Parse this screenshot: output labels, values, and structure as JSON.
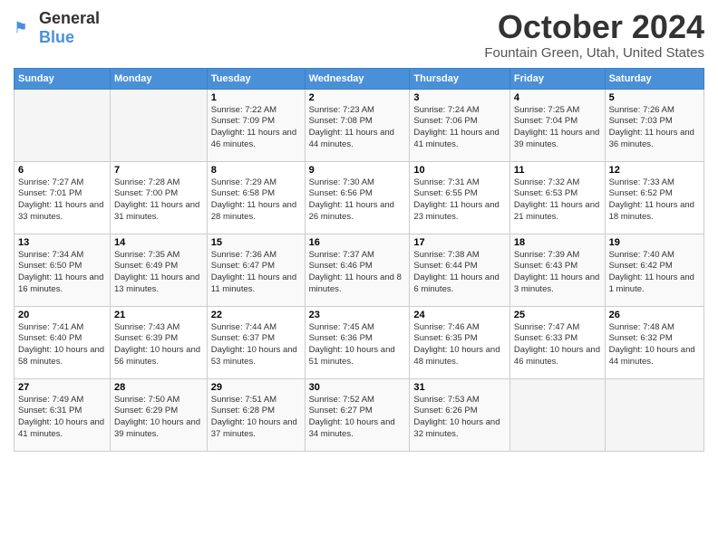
{
  "header": {
    "logo": {
      "general": "General",
      "blue": "Blue"
    },
    "title": "October 2024",
    "location": "Fountain Green, Utah, United States"
  },
  "weekdays": [
    "Sunday",
    "Monday",
    "Tuesday",
    "Wednesday",
    "Thursday",
    "Friday",
    "Saturday"
  ],
  "weeks": [
    [
      null,
      null,
      {
        "day": 1,
        "sunrise": "7:22 AM",
        "sunset": "7:09 PM",
        "daylight": "11 hours and 46 minutes."
      },
      {
        "day": 2,
        "sunrise": "7:23 AM",
        "sunset": "7:08 PM",
        "daylight": "11 hours and 44 minutes."
      },
      {
        "day": 3,
        "sunrise": "7:24 AM",
        "sunset": "7:06 PM",
        "daylight": "11 hours and 41 minutes."
      },
      {
        "day": 4,
        "sunrise": "7:25 AM",
        "sunset": "7:04 PM",
        "daylight": "11 hours and 39 minutes."
      },
      {
        "day": 5,
        "sunrise": "7:26 AM",
        "sunset": "7:03 PM",
        "daylight": "11 hours and 36 minutes."
      }
    ],
    [
      {
        "day": 6,
        "sunrise": "7:27 AM",
        "sunset": "7:01 PM",
        "daylight": "11 hours and 33 minutes."
      },
      {
        "day": 7,
        "sunrise": "7:28 AM",
        "sunset": "7:00 PM",
        "daylight": "11 hours and 31 minutes."
      },
      {
        "day": 8,
        "sunrise": "7:29 AM",
        "sunset": "6:58 PM",
        "daylight": "11 hours and 28 minutes."
      },
      {
        "day": 9,
        "sunrise": "7:30 AM",
        "sunset": "6:56 PM",
        "daylight": "11 hours and 26 minutes."
      },
      {
        "day": 10,
        "sunrise": "7:31 AM",
        "sunset": "6:55 PM",
        "daylight": "11 hours and 23 minutes."
      },
      {
        "day": 11,
        "sunrise": "7:32 AM",
        "sunset": "6:53 PM",
        "daylight": "11 hours and 21 minutes."
      },
      {
        "day": 12,
        "sunrise": "7:33 AM",
        "sunset": "6:52 PM",
        "daylight": "11 hours and 18 minutes."
      }
    ],
    [
      {
        "day": 13,
        "sunrise": "7:34 AM",
        "sunset": "6:50 PM",
        "daylight": "11 hours and 16 minutes."
      },
      {
        "day": 14,
        "sunrise": "7:35 AM",
        "sunset": "6:49 PM",
        "daylight": "11 hours and 13 minutes."
      },
      {
        "day": 15,
        "sunrise": "7:36 AM",
        "sunset": "6:47 PM",
        "daylight": "11 hours and 11 minutes."
      },
      {
        "day": 16,
        "sunrise": "7:37 AM",
        "sunset": "6:46 PM",
        "daylight": "11 hours and 8 minutes."
      },
      {
        "day": 17,
        "sunrise": "7:38 AM",
        "sunset": "6:44 PM",
        "daylight": "11 hours and 6 minutes."
      },
      {
        "day": 18,
        "sunrise": "7:39 AM",
        "sunset": "6:43 PM",
        "daylight": "11 hours and 3 minutes."
      },
      {
        "day": 19,
        "sunrise": "7:40 AM",
        "sunset": "6:42 PM",
        "daylight": "11 hours and 1 minute."
      }
    ],
    [
      {
        "day": 20,
        "sunrise": "7:41 AM",
        "sunset": "6:40 PM",
        "daylight": "10 hours and 58 minutes."
      },
      {
        "day": 21,
        "sunrise": "7:43 AM",
        "sunset": "6:39 PM",
        "daylight": "10 hours and 56 minutes."
      },
      {
        "day": 22,
        "sunrise": "7:44 AM",
        "sunset": "6:37 PM",
        "daylight": "10 hours and 53 minutes."
      },
      {
        "day": 23,
        "sunrise": "7:45 AM",
        "sunset": "6:36 PM",
        "daylight": "10 hours and 51 minutes."
      },
      {
        "day": 24,
        "sunrise": "7:46 AM",
        "sunset": "6:35 PM",
        "daylight": "10 hours and 48 minutes."
      },
      {
        "day": 25,
        "sunrise": "7:47 AM",
        "sunset": "6:33 PM",
        "daylight": "10 hours and 46 minutes."
      },
      {
        "day": 26,
        "sunrise": "7:48 AM",
        "sunset": "6:32 PM",
        "daylight": "10 hours and 44 minutes."
      }
    ],
    [
      {
        "day": 27,
        "sunrise": "7:49 AM",
        "sunset": "6:31 PM",
        "daylight": "10 hours and 41 minutes."
      },
      {
        "day": 28,
        "sunrise": "7:50 AM",
        "sunset": "6:29 PM",
        "daylight": "10 hours and 39 minutes."
      },
      {
        "day": 29,
        "sunrise": "7:51 AM",
        "sunset": "6:28 PM",
        "daylight": "10 hours and 37 minutes."
      },
      {
        "day": 30,
        "sunrise": "7:52 AM",
        "sunset": "6:27 PM",
        "daylight": "10 hours and 34 minutes."
      },
      {
        "day": 31,
        "sunrise": "7:53 AM",
        "sunset": "6:26 PM",
        "daylight": "10 hours and 32 minutes."
      },
      null,
      null
    ]
  ]
}
